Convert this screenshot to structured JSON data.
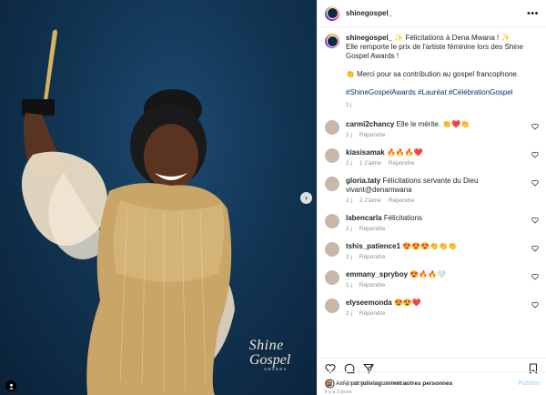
{
  "post": {
    "username": "shinegospel_",
    "logo": {
      "line1": "Shine",
      "line2": "Gospel",
      "line3": "AWARDS"
    },
    "caption": {
      "line1": "✨ Félicitations à Dena Mwana ! ✨",
      "line2": "Elle remporte le prix de l'artiste féminine lors des Shine Gospel Awards !",
      "line3": "👏 Merci pour sa contribution au gospel francophone.",
      "hashtags": "#ShineGospelAwards #Lauréat #CélébrationGospel",
      "time": "2 j"
    },
    "comments": [
      {
        "user": "carmi2chancy",
        "text": "Elle le mérite. 👏❤️👏",
        "time": "1 j",
        "likes": "",
        "reply": "Répondre"
      },
      {
        "user": "kiasisamak",
        "text": "🔥🔥🔥❤️",
        "time": "2 j",
        "likes": "1 J'aime",
        "reply": "Répondre"
      },
      {
        "user": "gloria.taty",
        "text": "Félicitations servante du Dieu vivant@denamwana",
        "time": "2 j",
        "likes": "2 J'aime",
        "reply": "Répondre"
      },
      {
        "user": "labencarla",
        "text": "Félicitations",
        "time": "2 j",
        "likes": "",
        "reply": "Répondre"
      },
      {
        "user": "tshis_patience1",
        "text": "😍😍😍👏👏👏",
        "time": "2 j",
        "likes": "",
        "reply": "Répondre"
      },
      {
        "user": "emmany_spryboy",
        "text": "😍🔥🔥🤍",
        "time": "1 j",
        "likes": "",
        "reply": "Répondre"
      },
      {
        "user": "elyseemonda",
        "text": "😍😍❤️",
        "time": "2 j",
        "likes": "",
        "reply": "Répondre"
      }
    ],
    "liked_by": {
      "prefix": "Aimé par ",
      "user": "julielaguerre",
      "suffix": " et autres personnes"
    },
    "posted_ago": "il y a 2 jours",
    "comment_placeholder": "Ajouter un commentaire…",
    "publish_label": "Publier"
  },
  "colors": {
    "link": "#00376b",
    "muted": "#8e8e8e",
    "photo_bg": "#123553"
  }
}
